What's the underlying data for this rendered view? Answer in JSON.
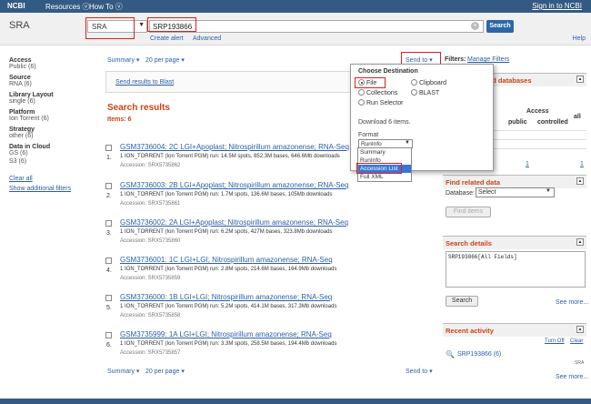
{
  "topbar": {
    "logo": "NCBI",
    "resources": "Resources",
    "howto": "How To",
    "signin": "Sign in to NCBI"
  },
  "header": {
    "db_name": "SRA",
    "db_select": "SRA",
    "search_term": "SRP193866",
    "search_button": "Search",
    "create_alert": "Create alert",
    "advanced": "Advanced",
    "help": "Help"
  },
  "filters": [
    {
      "title": "Access",
      "value": "Public (6)"
    },
    {
      "title": "Source",
      "value": "RNA (6)"
    },
    {
      "title": "Library Layout",
      "value": "single (6)"
    },
    {
      "title": "Platform",
      "value": "Ion Torrent (6)"
    },
    {
      "title": "Strategy",
      "value": "other (6)"
    },
    {
      "title": "Data in Cloud",
      "value": "GS (6)",
      "value2": "S3 (6)"
    }
  ],
  "clear_all": "Clear all",
  "show_filters": "Show additional filters",
  "controls": {
    "summary": "Summary",
    "per_page": "20 per page",
    "sendto": "Send to",
    "filters_label": "Filters:",
    "manage_filters": "Manage Filters"
  },
  "send_blast": "Send results to Blast",
  "search_results": "Search results",
  "items_count": "Items: 6",
  "results": [
    {
      "num": "1.",
      "title": "GSM3736004: 2C LGI+Apoplast; Nitrospirillum amazonense; RNA-Seq",
      "desc": "1 ION_TORRENT (Ion Torrent PGM) run: 14.5M spots, 852.3M bases, 646.6Mb downloads",
      "acc": "Accession: SRX5735862"
    },
    {
      "num": "2.",
      "title": "GSM3736003: 2B LGI+Apoplast; Nitrospirillum amazonense; RNA-Seq",
      "desc": "1 ION_TORRENT (Ion Torrent PGM) run: 1.7M spots, 136.6M bases, 105Mb downloads",
      "acc": "Accession: SRX5735861"
    },
    {
      "num": "3.",
      "title": "GSM3736002: 2A LGI+Apoplast; Nitrospirillum amazonense; RNA-Seq",
      "desc": "1 ION_TORRENT (Ion Torrent PGM) run: 6.2M spots, 427M bases, 323.8Mb downloads",
      "acc": "Accession: SRX5735860"
    },
    {
      "num": "4.",
      "title": "GSM3736001: 1C LGI+LGI; Nitrospirillum amazonense; RNA-Seq",
      "desc": "1 ION_TORRENT (Ion Torrent PGM) run: 2.8M spots, 214.6M bases, 164.9Mb downloads",
      "acc": "Accession: SRX5735859"
    },
    {
      "num": "5.",
      "title": "GSM3736000: 1B LGI+LGI; Nitrospirillum amazonense; RNA-Seq",
      "desc": "1 ION_TORRENT (Ion Torrent PGM) run: 5.2M spots, 414.1M bases, 317.3Mb downloads",
      "acc": "Accession: SRX5735858"
    },
    {
      "num": "6.",
      "title": "GSM3735999: 1A LGI+LGI; Nitrospirillum amazonense; RNA-Seq",
      "desc": "1 ION_TORRENT (Ion Torrent PGM) run: 3.3M spots, 258.5M bases, 194.4Mb downloads",
      "acc": "Accession: SRX5735857"
    }
  ],
  "popup": {
    "title": "Choose Destination",
    "options": [
      "File",
      "Clipboard",
      "Collections",
      "BLAST",
      "Run Selector"
    ],
    "selected": "File",
    "download": "Download 6 items.",
    "format_label": "Format",
    "format_value": "RunInfo",
    "format_options": [
      "Summary",
      "RunInfo",
      "Accession List",
      "Full XML"
    ],
    "format_highlight": "Accession List"
  },
  "right": {
    "related_db_title": "ed databases",
    "access_header": "Access",
    "col_public": "public",
    "col_controlled": "controlled",
    "col_all": "all",
    "val_1": "1",
    "val_2": "1",
    "find_related_title": "Find related data",
    "database_label": "Database:",
    "database_select": "Select",
    "find_items": "Find items",
    "search_details_title": "Search details",
    "search_details_text": "SRP193866[All Fields]",
    "search_btn": "Search",
    "see_more": "See more...",
    "recent_title": "Recent activity",
    "turn_off": "Turn Off",
    "clear": "Clear",
    "recent_item": "SRP193866 (6)",
    "recent_db": "SRA",
    "see_more2": "See more..."
  }
}
